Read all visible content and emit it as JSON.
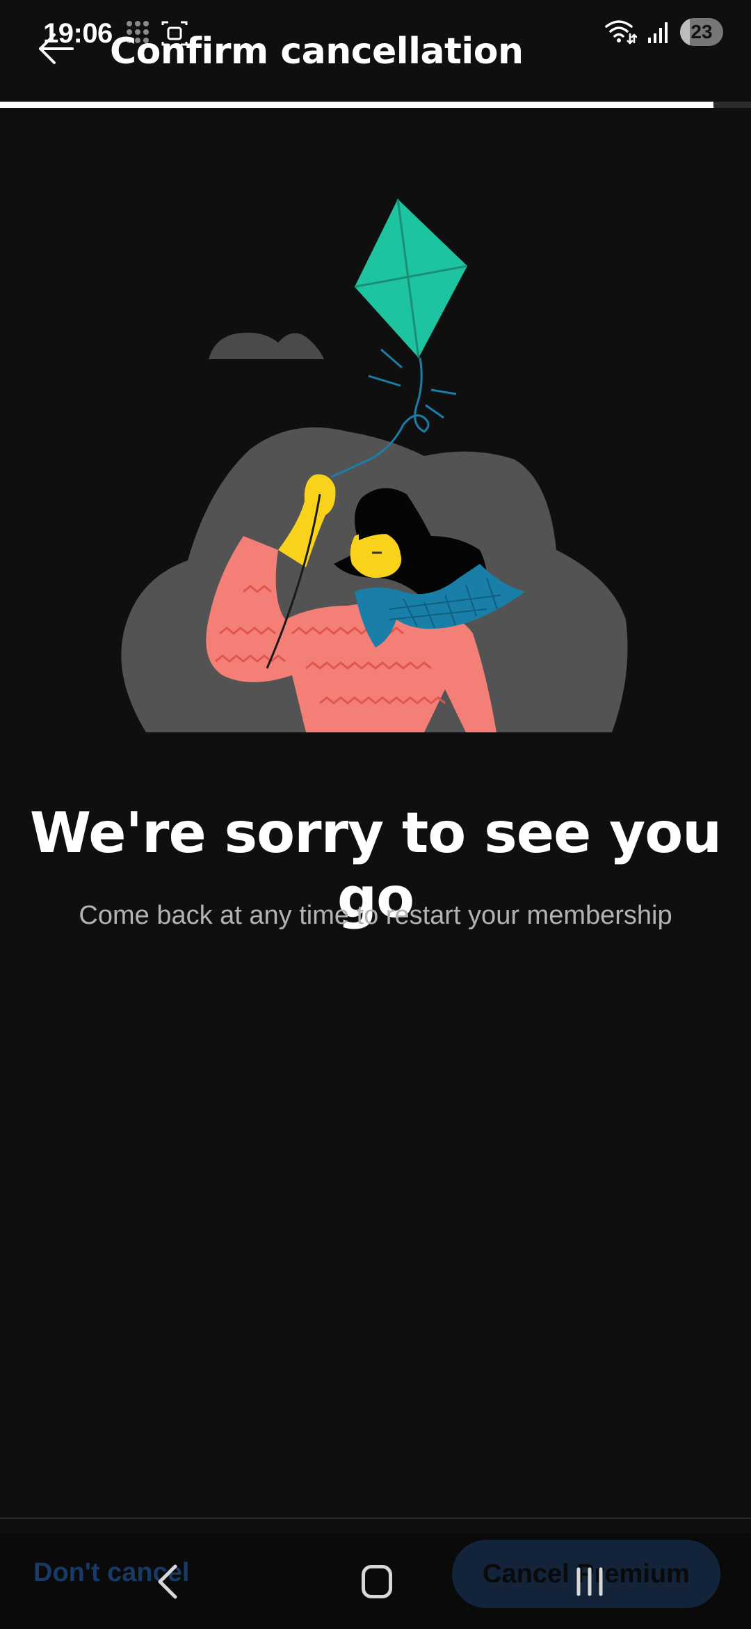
{
  "status_bar": {
    "time": "19:06",
    "battery_level": "23",
    "battery_fraction": 0.23
  },
  "header": {
    "title": "Confirm cancellation",
    "back_icon": "arrow-left-icon"
  },
  "progress": {
    "fraction": 0.95
  },
  "main": {
    "headline": "We're sorry to see you go",
    "subtext": "Come back at any time to restart your membership"
  },
  "actions": {
    "dont_cancel_label": "Don't cancel",
    "cancel_premium_label": "Cancel Premium"
  },
  "colors": {
    "background": "#0f0f0f",
    "kite": "#1ec4a0",
    "sweater": "#f47f77",
    "scarf": "#1a7fa8",
    "skin": "#f9d21c",
    "cloud": "#535353"
  }
}
